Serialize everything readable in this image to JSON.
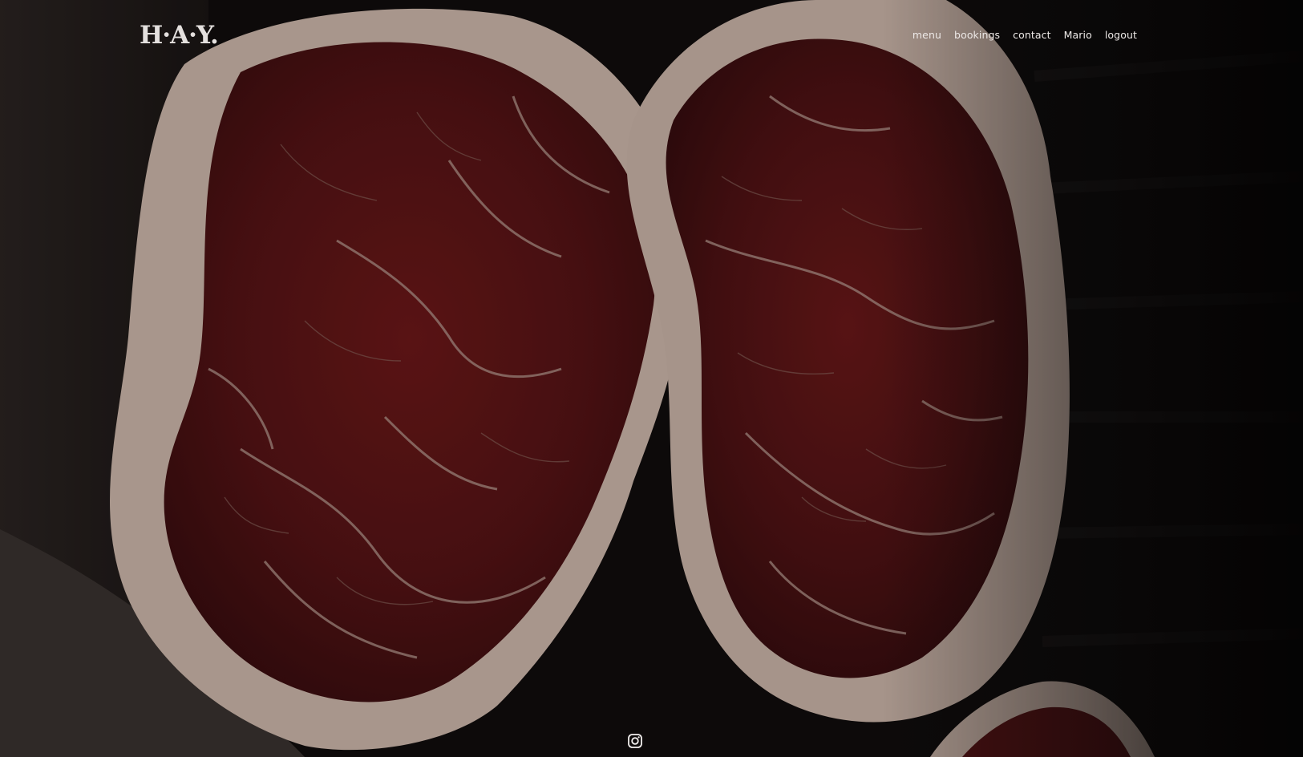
{
  "brand": {
    "logo_text": "H·A·Y."
  },
  "nav": {
    "items": [
      {
        "label": "menu"
      },
      {
        "label": "bookings"
      },
      {
        "label": "contact"
      },
      {
        "label": "Mario"
      },
      {
        "label": "logout"
      }
    ]
  },
  "hero": {
    "image": "raw-ribeye-steaks-photo"
  },
  "footer": {
    "social_icon": "instagram-icon"
  },
  "colors": {
    "text": "#ece8e6",
    "background": "#0d0b0b",
    "meat": "#6e1a1c",
    "fat": "#d9c7bd"
  }
}
